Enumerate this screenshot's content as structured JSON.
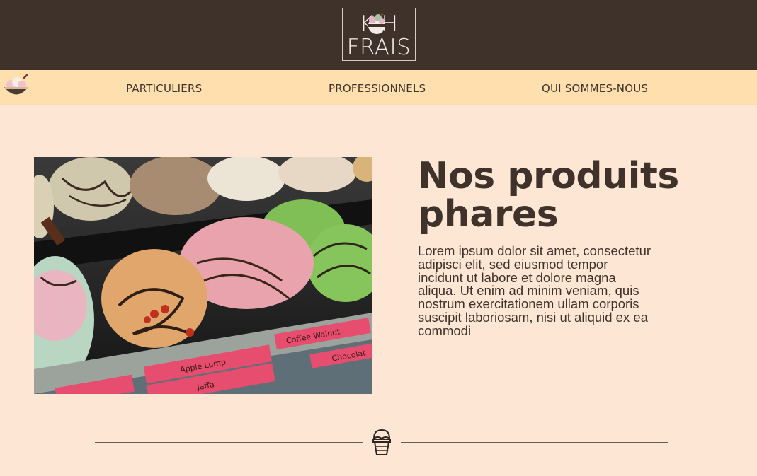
{
  "header": {
    "logo_line1": "K H",
    "logo_line2": "FRAIS"
  },
  "nav": {
    "items": [
      {
        "label": "PARTICULIERS"
      },
      {
        "label": "PROFESSIONNELS"
      },
      {
        "label": "QUI SOMMES-NOUS"
      }
    ]
  },
  "main": {
    "title": "Nos produits phares",
    "text": "Lorem ipsum dolor sit amet, consectetur adipisci elit, sed eiusmod tempor incidunt ut labore et dolore magna aliqua. Ut enim ad minim veniam, quis nostrum exercitationem ullam corporis suscipit laboriosam, nisi ut aliquid ex ea commodi",
    "image_labels": [
      "Coffee Walnut",
      "Chocolat",
      "Apple Lump",
      "Jaffa"
    ]
  },
  "colors": {
    "header_bg": "#3e322b",
    "nav_bg": "#ffdfae",
    "page_bg": "#fde6d4",
    "text": "#3e322b"
  },
  "icons": {
    "logo": "ice-cream-scoop-logo",
    "nav": "ice-cream-bowl-icon",
    "divider": "ice-cream-cup-icon"
  }
}
